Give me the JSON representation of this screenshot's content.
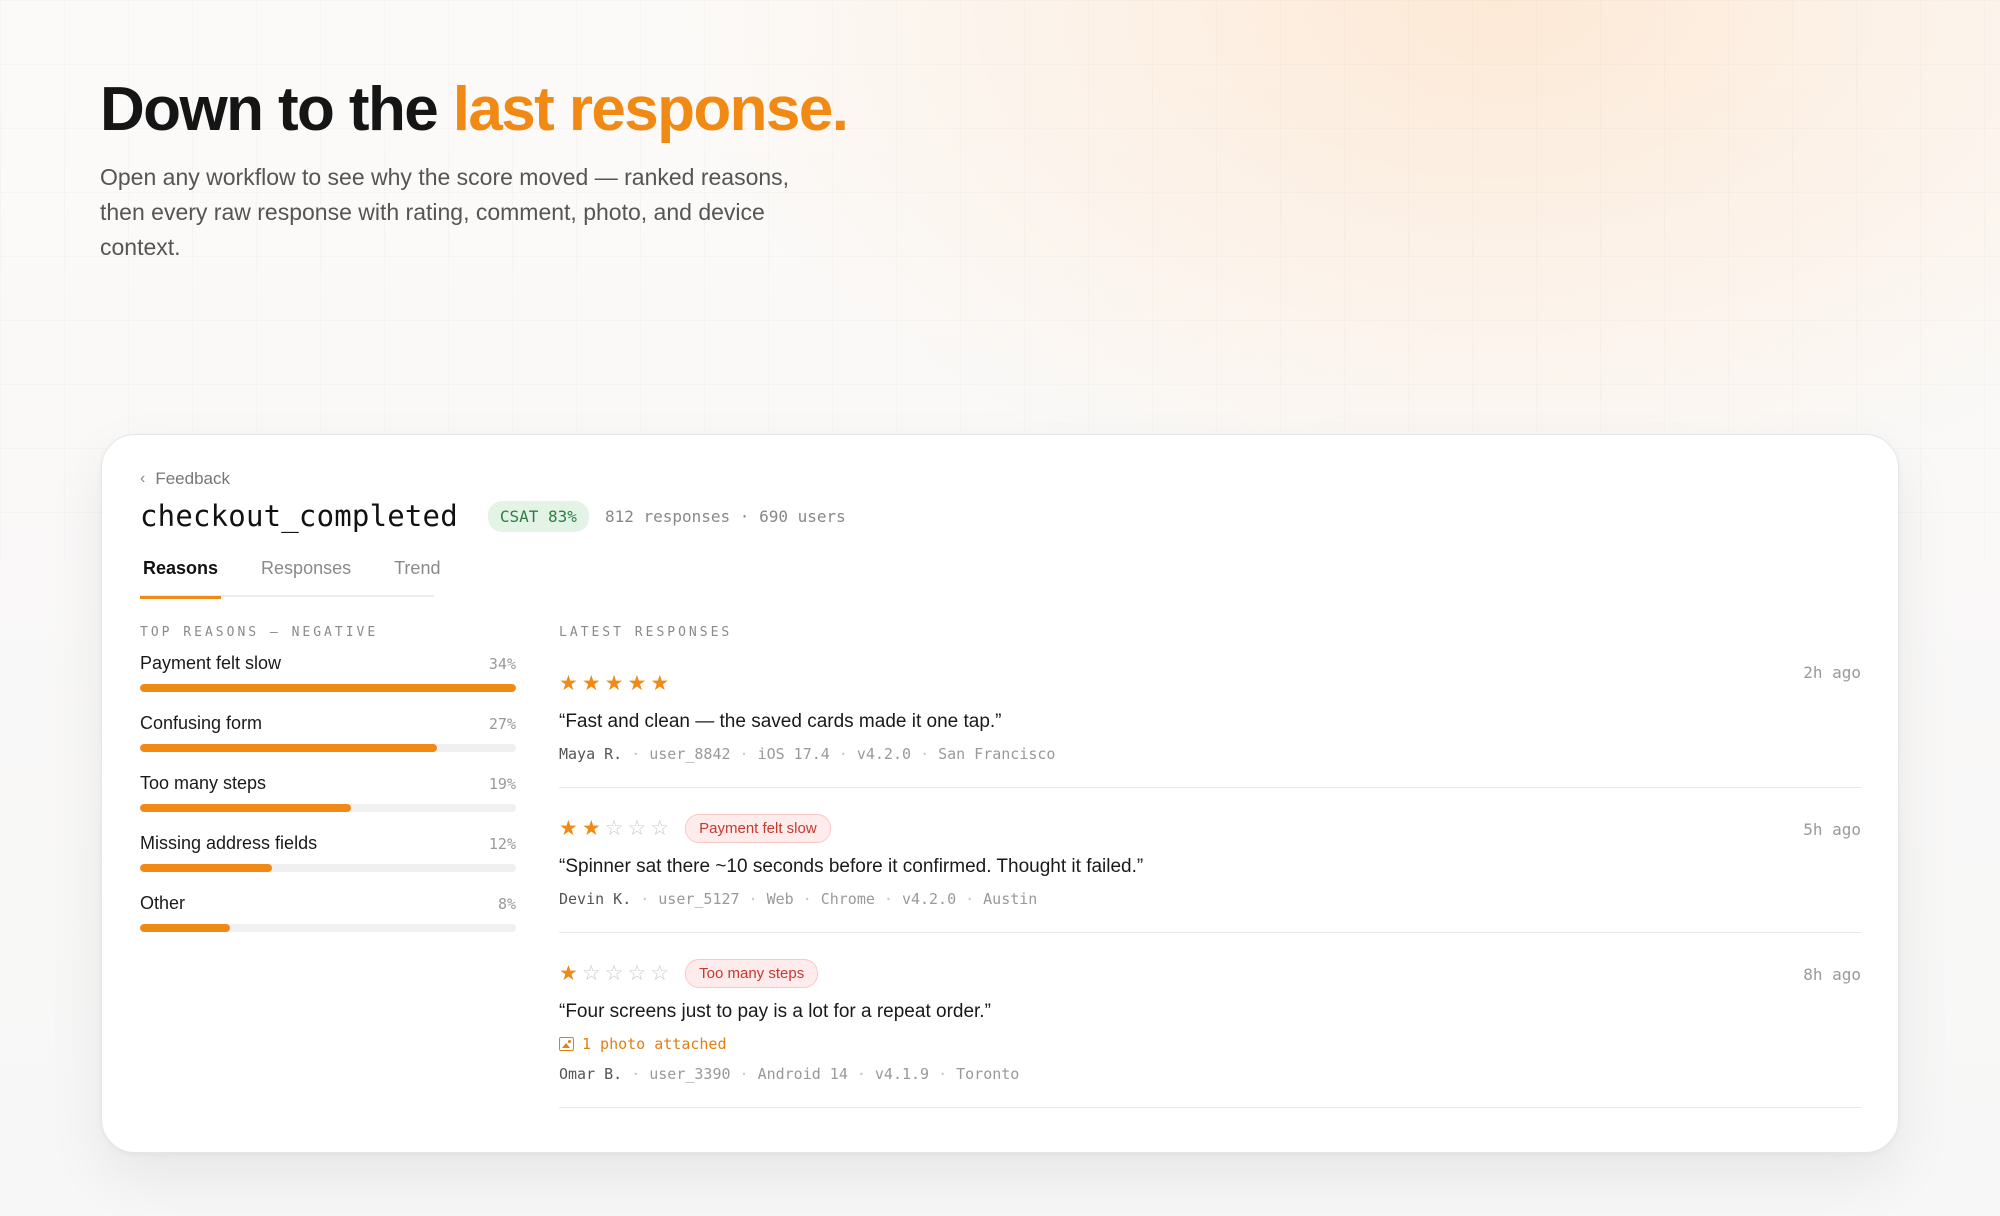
{
  "hero": {
    "title_main": "Down to the",
    "title_accent": "last response.",
    "subtitle": "Open any workflow to see why the score moved — ranked reasons, then every raw response with rating, comment, photo, and device context."
  },
  "colors": {
    "accent": "#f08a14",
    "csat_bg": "#e3f4e7",
    "csat_text": "#2d7d45",
    "tag_bg": "#fdeceb",
    "tag_text": "#c7382f"
  },
  "breadcrumb": {
    "icon": "chevron-left-icon",
    "label": "Feedback"
  },
  "workflow": {
    "name": "checkout_completed",
    "csat": "CSAT 83%",
    "meta": "812 responses · 690 users"
  },
  "tabs": [
    {
      "label": "Reasons",
      "active": true
    },
    {
      "label": "Responses",
      "active": false
    },
    {
      "label": "Trend",
      "active": false
    }
  ],
  "reasons": {
    "heading": "TOP REASONS — NEGATIVE",
    "items": [
      {
        "label": "Payment felt slow",
        "pct": "34%",
        "fill": 1.0
      },
      {
        "label": "Confusing form",
        "pct": "27%",
        "fill": 0.79
      },
      {
        "label": "Too many steps",
        "pct": "19%",
        "fill": 0.56
      },
      {
        "label": "Missing address fields",
        "pct": "12%",
        "fill": 0.35
      },
      {
        "label": "Other",
        "pct": "8%",
        "fill": 0.24
      }
    ]
  },
  "responses": {
    "heading": "LATEST RESPONSES",
    "items": [
      {
        "rating": 5,
        "tag": "",
        "time": "2h ago",
        "quote": "“Fast and clean — the saved cards made it one tap.”",
        "photo": "",
        "device": [
          "Maya R.",
          "user_8842",
          "iOS 17.4",
          "v4.2.0",
          "San Francisco"
        ]
      },
      {
        "rating": 2,
        "tag": "Payment felt slow",
        "time": "5h ago",
        "quote": "“Spinner sat there ~10 seconds before it confirmed. Thought it failed.”",
        "photo": "",
        "device": [
          "Devin K.",
          "user_5127",
          "Web",
          "Chrome",
          "v4.2.0",
          "Austin"
        ]
      },
      {
        "rating": 1,
        "tag": "Too many steps",
        "time": "8h ago",
        "quote": "“Four screens just to pay is a lot for a repeat order.”",
        "photo": "1 photo attached",
        "device": [
          "Omar B.",
          "user_3390",
          "Android 14",
          "v4.1.9",
          "Toronto"
        ]
      }
    ]
  }
}
